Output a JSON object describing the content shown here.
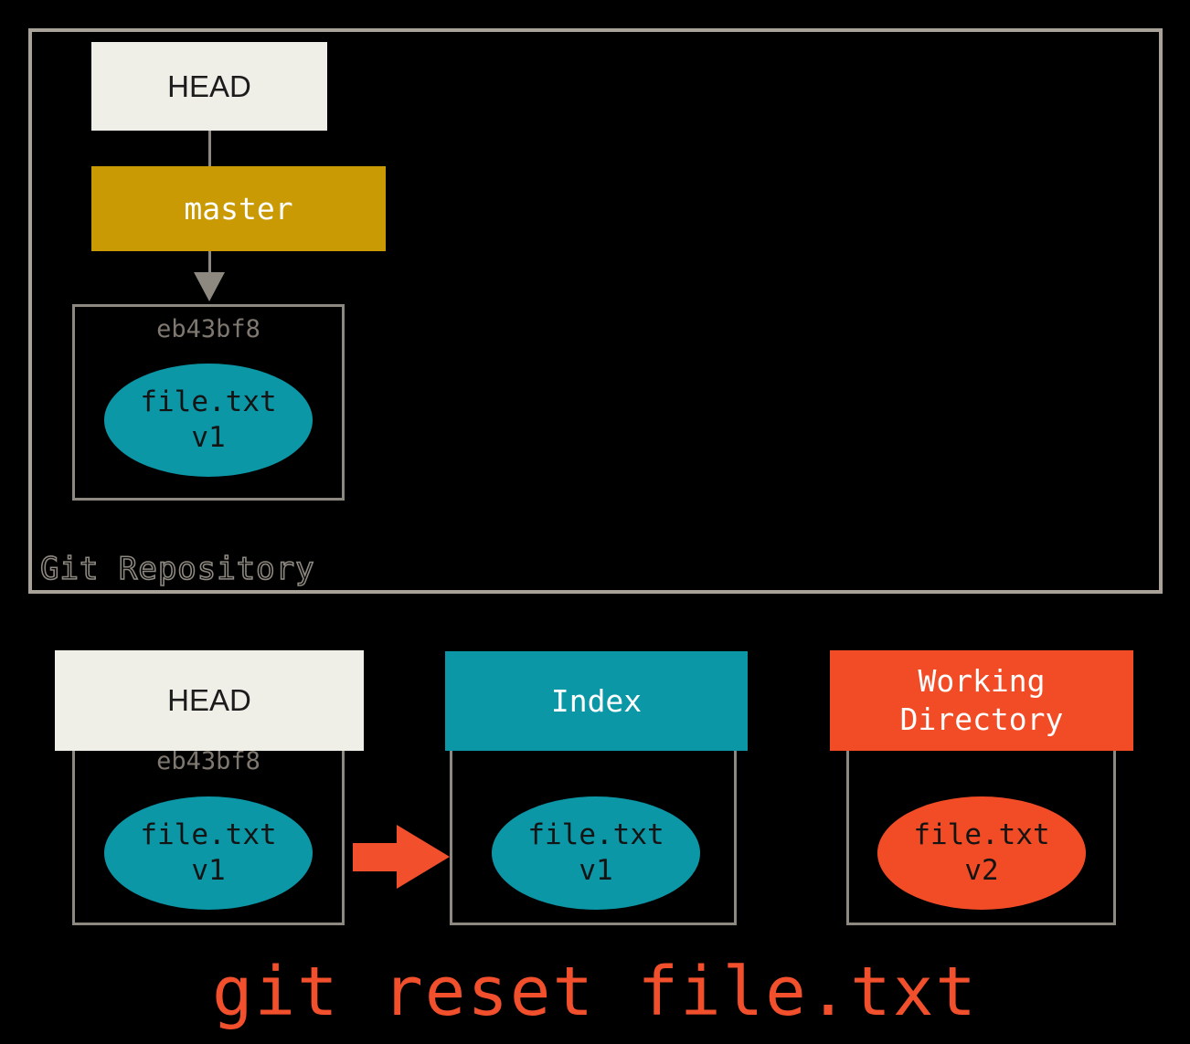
{
  "diagram": {
    "background_color": "#000000",
    "caption": "git reset file.txt",
    "caption_color": "#f2502d"
  },
  "repository": {
    "label": "Git Repository",
    "border_color": "#a9a299",
    "head": {
      "label": "HEAD",
      "color": "#efeee7"
    },
    "branch": {
      "label": "master",
      "color": "#c99a04"
    },
    "commit": {
      "hash": "eb43bf8",
      "file_name": "file.txt",
      "file_version": "v1",
      "blob_color": "#0c97a7"
    }
  },
  "areas": {
    "head": {
      "title": "HEAD",
      "title_color": "#efeee7",
      "hash": "eb43bf8",
      "file_name": "file.txt",
      "file_version": "v1",
      "blob_color": "#0c97a7"
    },
    "index": {
      "title": "Index",
      "title_color": "#0c97a7",
      "file_name": "file.txt",
      "file_version": "v1",
      "blob_color": "#0c97a7"
    },
    "working_directory": {
      "title_line1": "Working",
      "title_line2": "Directory",
      "title_color": "#f24c27",
      "file_name": "file.txt",
      "file_version": "v2",
      "blob_color": "#f24c27"
    }
  },
  "flow": {
    "arrow_color": "#f2502d",
    "arrow_from": "HEAD",
    "arrow_to": "Index"
  }
}
